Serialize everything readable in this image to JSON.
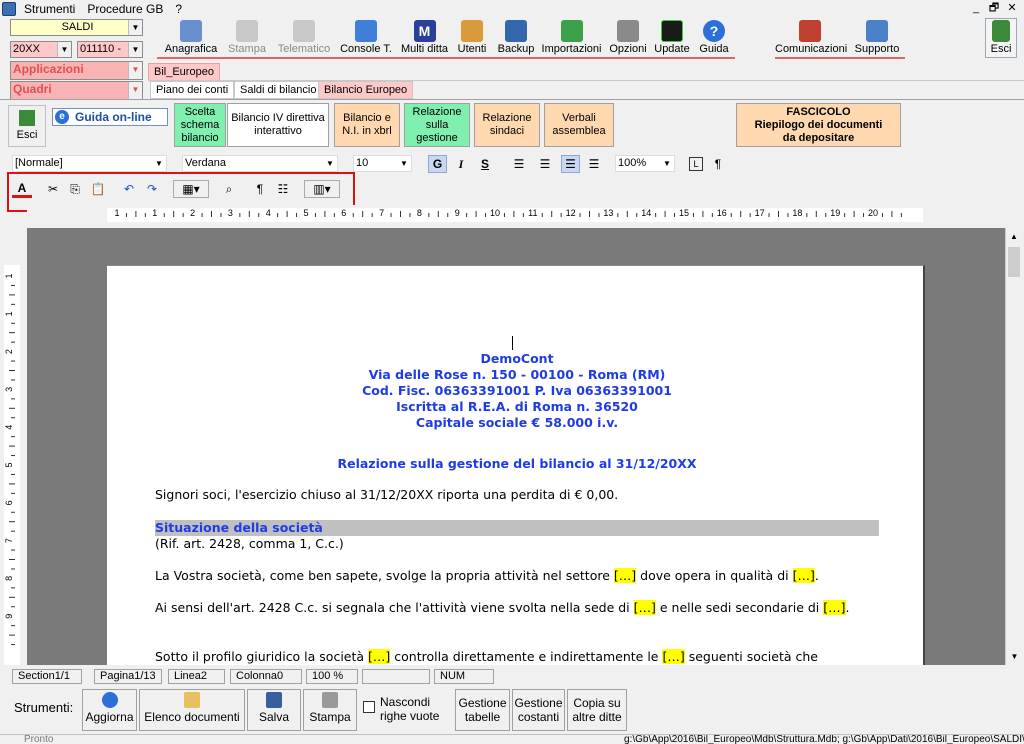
{
  "menu": {
    "items": [
      "Strumenti",
      "Procedure GB",
      "?"
    ]
  },
  "window_controls": [
    "_",
    "🗗",
    "✕"
  ],
  "left_panel": {
    "saldi": "SALDI",
    "year": "20XX",
    "code": "011110 -",
    "applicazioni": "Applicazioni",
    "quadri": "Quadri"
  },
  "toolbar": [
    {
      "label": "Anagrafica",
      "enabled": true
    },
    {
      "label": "Stampa",
      "enabled": false
    },
    {
      "label": "Telematico",
      "enabled": false
    },
    {
      "label": "Console T.",
      "enabled": true
    },
    {
      "label": "Multi ditta",
      "enabled": true
    },
    {
      "label": "Utenti",
      "enabled": true
    },
    {
      "label": "Backup",
      "enabled": true
    },
    {
      "label": "Importazioni",
      "enabled": true
    },
    {
      "label": "Opzioni",
      "enabled": true
    },
    {
      "label": "Update",
      "enabled": true
    },
    {
      "label": "Guida",
      "enabled": true
    },
    {
      "label": "Comunicazioni",
      "enabled": true
    },
    {
      "label": "Supporto",
      "enabled": true
    },
    {
      "label": "Esci",
      "enabled": true
    }
  ],
  "tabs": {
    "top": "Bil_Europeo",
    "sub": [
      "Piano dei conti",
      "Saldi di bilancio",
      "Bilancio Europeo"
    ]
  },
  "section_buttons": {
    "esci": "Esci",
    "guida": "Guida on-line",
    "items": [
      "Scelta schema bilancio",
      "Bilancio IV direttiva interattivo",
      "Bilancio e N.I. in xbrl",
      "Relazione sulla gestione",
      "Relazione sindaci",
      "Verbali assemblea"
    ],
    "fascicolo_title": "FASCICOLO",
    "fascicolo_line1": "Riepilogo dei documenti",
    "fascicolo_line2": "da depositare"
  },
  "format_bar": {
    "style": "[Normale]",
    "font": "Verdana",
    "size": "10",
    "zoom": "100%"
  },
  "ruler": {
    "ticks": [
      "1",
      "1",
      "2",
      "3",
      "4",
      "5",
      "6",
      "7",
      "8",
      "9",
      "10",
      "11",
      "12",
      "13",
      "14",
      "15",
      "16",
      "17",
      "18",
      "19",
      "20"
    ]
  },
  "vruler": [
    "1",
    "1",
    "2",
    "3",
    "4",
    "5",
    "6",
    "7",
    "8",
    "9"
  ],
  "document": {
    "company": "DemoCont",
    "address": "Via delle Rose n. 150 - 00100 - Roma (RM)",
    "fiscal": "Cod. Fisc. 06363391001 P. Iva 06363391001",
    "rea": "Iscritta al R.E.A. di Roma n. 36520",
    "capital": "Capitale sociale € 58.000 i.v.",
    "title": "Relazione sulla gestione del bilancio al 31/12/20XX",
    "p1": "Signori soci, l'esercizio chiuso al 31/12/20XX riporta una perdita di € 0,00.",
    "section": "Situazione della società",
    "section_ref": "(Rif. art. 2428, comma 1, C.c.)",
    "p2a": "La Vostra società, come ben sapete, svolge la propria attività nel settore",
    "p2b": "dove opera in qualità di",
    "p3a": "Ai sensi dell'art. 2428 C.c. si segnala che l'attività viene svolta nella sede di",
    "p3b": "e nelle sedi secondarie di",
    "p4a": "Sotto il profilo giuridico la società",
    "p4b": "controlla direttamente e indirettamente le",
    "p4c": "seguenti società che",
    "placeholder": "[…]",
    "period": "."
  },
  "status_bar": {
    "section": "Section1/1",
    "page": "Pagina1/13",
    "line": "Linea2",
    "column": "Colonna0",
    "zoom": "100 %",
    "num": "NUM"
  },
  "bottom": {
    "label": "Strumenti:",
    "buttons": [
      "Aggiorna",
      "Elenco documenti",
      "Salva",
      "Stampa"
    ],
    "checkbox": "Nascondi righe vuote",
    "buttons2": [
      "Gestione tabelle",
      "Gestione costanti",
      "Copia su altre ditte"
    ]
  },
  "footer": {
    "left": "Pronto",
    "path": "g:\\Gb\\App\\2016\\Bil_Europeo\\Mdb\\Struttura.Mdb; g:\\Gb\\App\\Dati\\2016\\Bil_Europeo\\SALDI\\Dati."
  }
}
